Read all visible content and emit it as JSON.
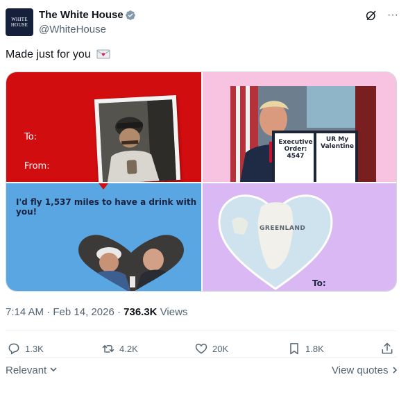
{
  "account": {
    "name": "The White House",
    "handle": "@WhiteHouse",
    "avatar_line1": "WHITE",
    "avatar_line2": "HOUSE"
  },
  "tweet": {
    "text": "Made just for you",
    "text_emoji": "love-letter-emoji"
  },
  "cards": {
    "card1": {
      "to": "To:",
      "from": "From:"
    },
    "card2": {
      "doc_left": "Executive Order: 4547",
      "doc_right": "UR My Valentine"
    },
    "card3": {
      "caption": "I'd fly 1,537 miles to have a drink with you!"
    },
    "card4": {
      "map_label": "GREENLAND",
      "to": "To:"
    }
  },
  "meta": {
    "time": "7:14 AM",
    "sep": "·",
    "date": "Feb 14, 2026",
    "views_count": "736.3K",
    "views_label": "Views"
  },
  "actions": {
    "replies": "1.3K",
    "reposts": "4.2K",
    "likes": "20K",
    "bookmarks": "1.8K"
  },
  "footer": {
    "sort_label": "Relevant",
    "view_quotes": "View quotes"
  },
  "colors": {
    "card_red": "#d20d0f",
    "card_pink": "#f8c3e0",
    "card_blue": "#5aa6e3",
    "card_purple": "#d9b8f3",
    "verified": "#829aab"
  }
}
